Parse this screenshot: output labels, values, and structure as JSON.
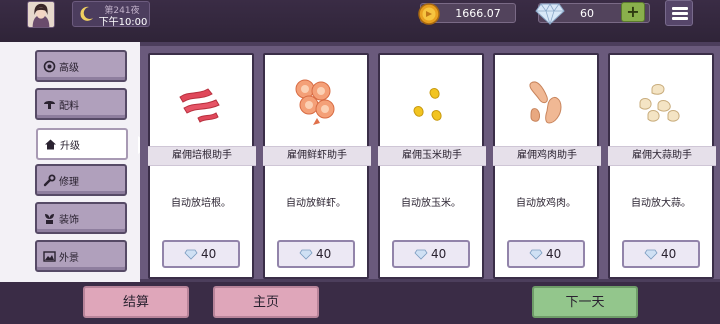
{
  "top_bar": {
    "clock": {
      "night": "第241夜",
      "time": "下午10:00"
    },
    "coins": "1666.07",
    "gems": "60",
    "add_gems_label": "+"
  },
  "tabs": [
    {
      "label": "高级",
      "icon": "medal-icon",
      "active": false
    },
    {
      "label": "配料",
      "icon": "mushroom-icon",
      "active": false
    },
    {
      "label": "升级",
      "icon": "house-icon",
      "active": true
    },
    {
      "label": "修理",
      "icon": "wrench-icon",
      "active": false
    },
    {
      "label": "装饰",
      "icon": "plant-icon",
      "active": false
    },
    {
      "label": "外景",
      "icon": "landscape-icon",
      "active": false
    }
  ],
  "cards": [
    {
      "title": "雇佣培根助手",
      "description": "自动放培根。",
      "price": "40",
      "image": "bacon-icon"
    },
    {
      "title": "雇佣鲜虾助手",
      "description": "自动放鲜虾。",
      "price": "40",
      "image": "shrimp-icon"
    },
    {
      "title": "雇佣玉米助手",
      "description": "自动放玉米。",
      "price": "40",
      "image": "corn-icon"
    },
    {
      "title": "雇佣鸡肉助手",
      "description": "自动放鸡肉。",
      "price": "40",
      "image": "chicken-icon"
    },
    {
      "title": "雇佣大蒜助手",
      "description": "自动放大蒜。",
      "price": "40",
      "image": "garlic-icon"
    }
  ],
  "bottom_bar": {
    "settle_label": "结算",
    "home_label": "主页",
    "next_day_label": "下一天"
  },
  "colors": {
    "accent_pink": "#dfa6ba",
    "accent_green": "#93c68c",
    "panel_purple": "#6a5a7c"
  }
}
